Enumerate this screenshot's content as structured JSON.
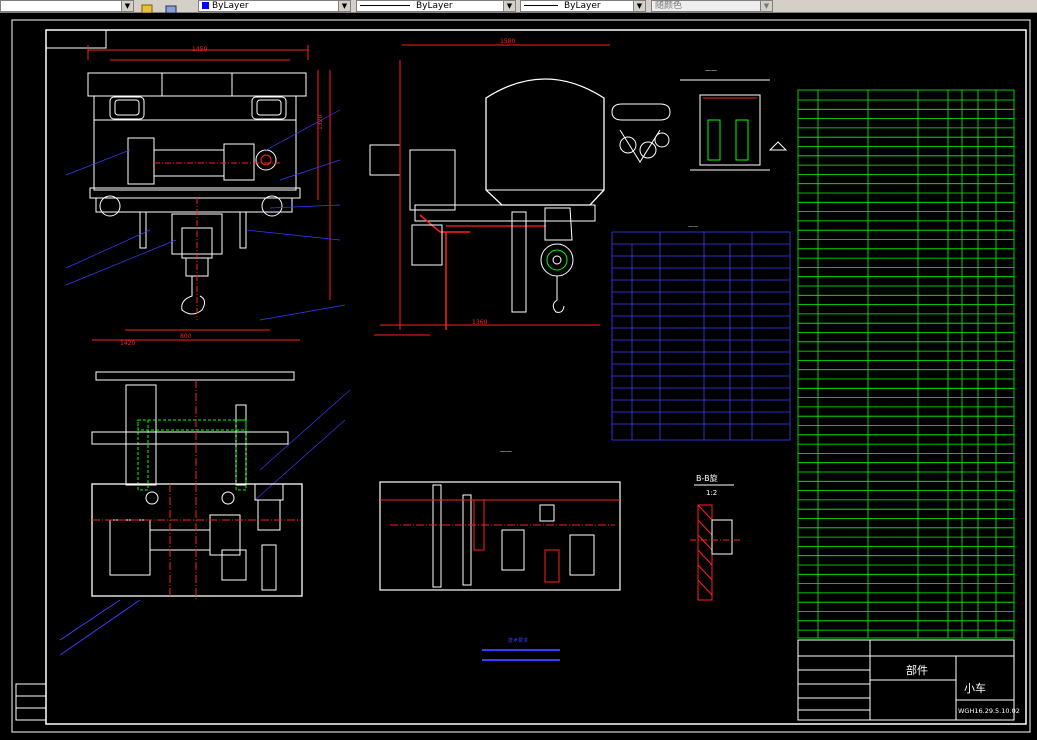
{
  "toolbar": {
    "layer_color": "ByLayer",
    "linetype": "ByLayer",
    "lineweight": "ByLayer",
    "plot_style": "随颜色"
  },
  "drawing": {
    "section_label": "B-B旋",
    "scale_label": "1:2",
    "title_part": "部件",
    "title_name": "小车",
    "drawing_number": "WGH16.29.5.10.02",
    "notes_title": "技术要求"
  },
  "colors": {
    "drawing_blue": "#3b3bff",
    "table_green": "#00ff00",
    "dim_red": "#ff2020",
    "white": "#ffffff",
    "cyan": "#00ffff",
    "yellow": "#ffff00"
  }
}
